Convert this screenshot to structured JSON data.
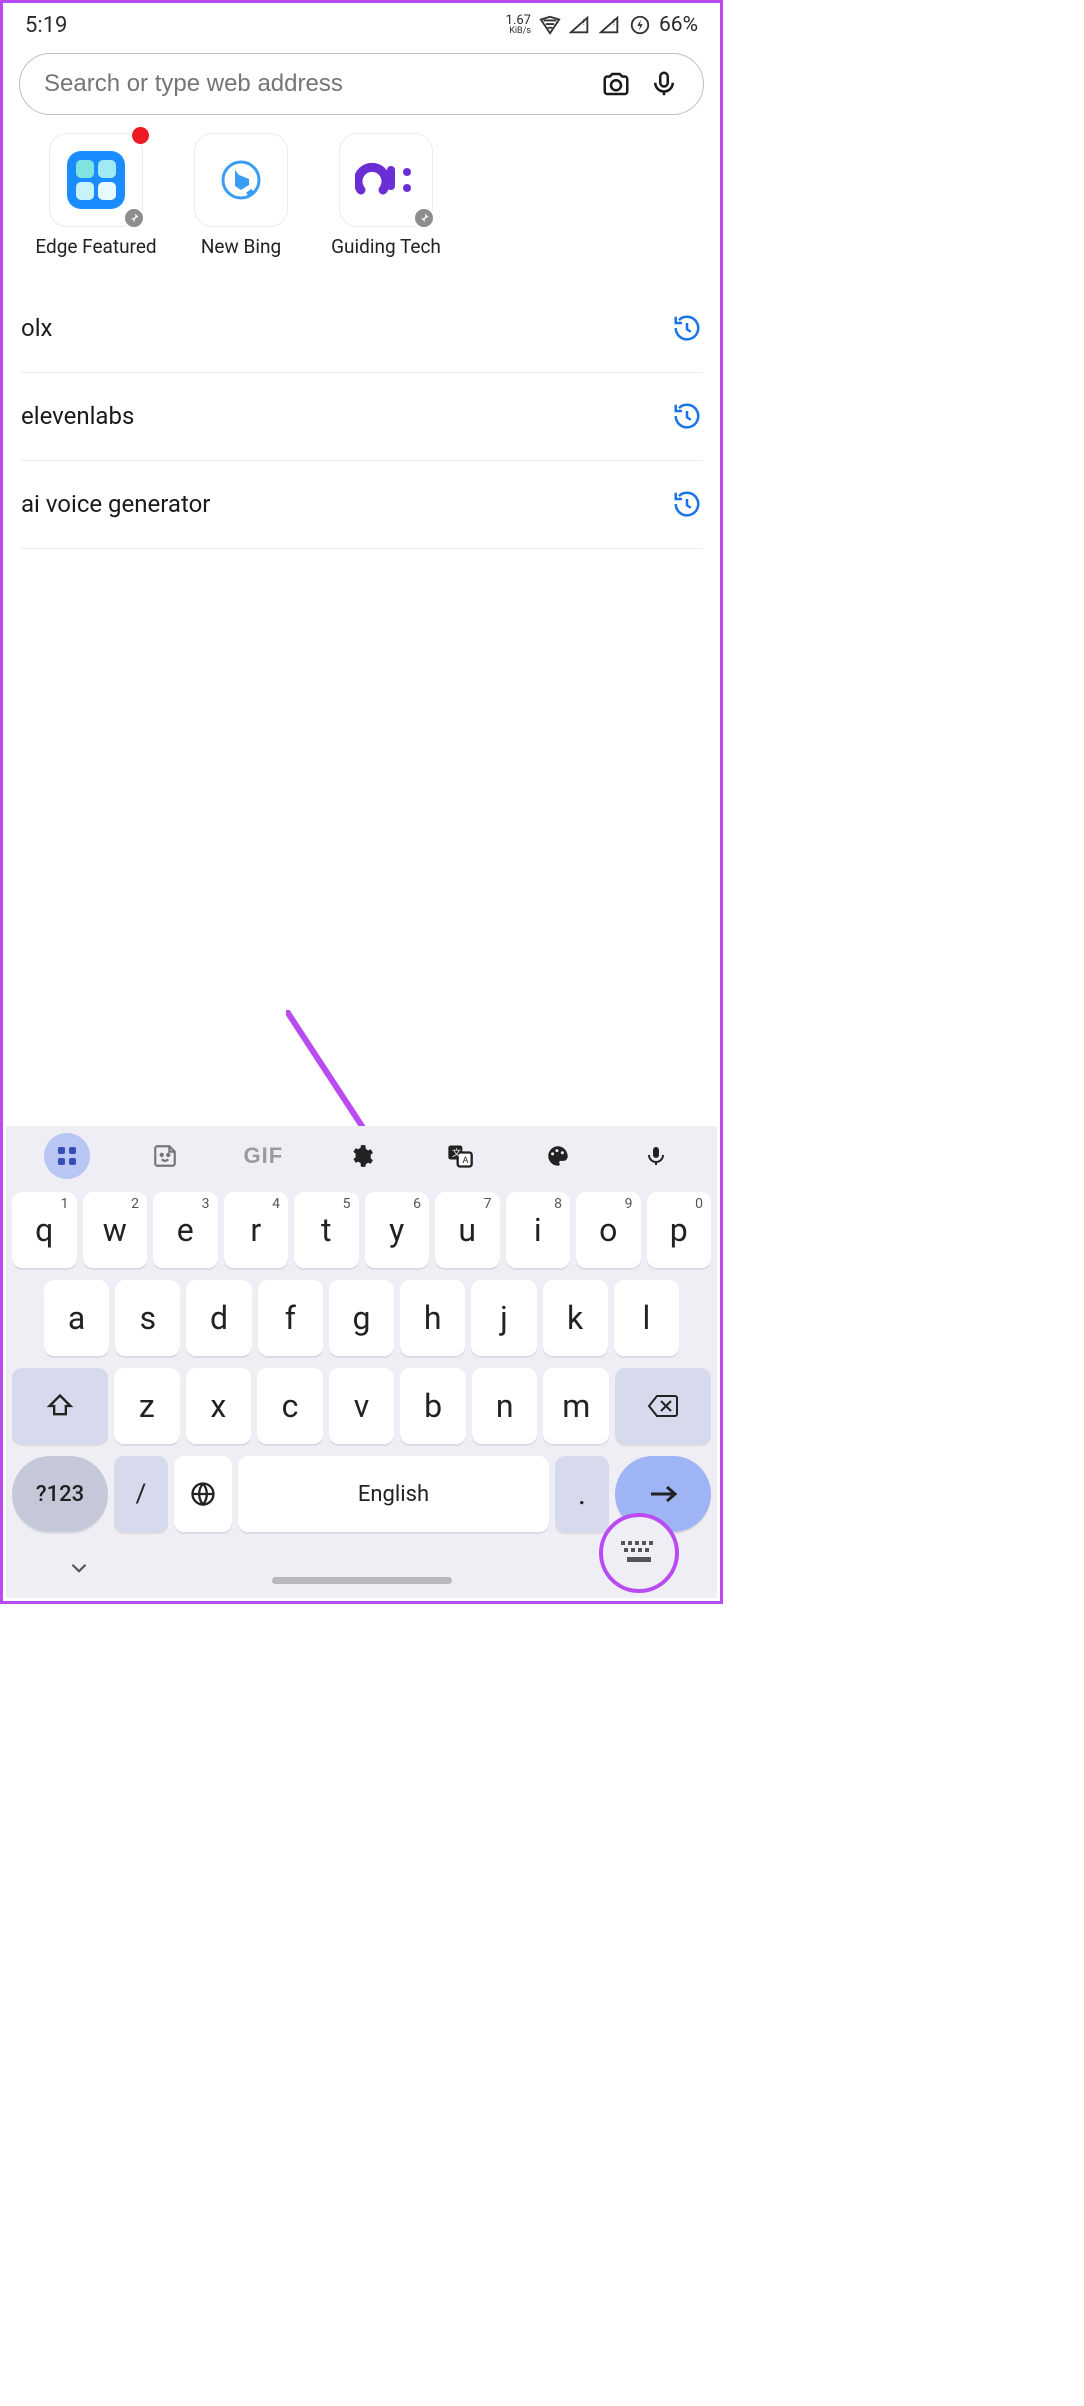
{
  "status": {
    "time": "5:19",
    "kib_top": "1.67",
    "kib_bot": "KiB/s",
    "battery": "66%"
  },
  "address": {
    "placeholder": "Search or type web address"
  },
  "dials": [
    {
      "label": "Edge Featured"
    },
    {
      "label": "New Bing"
    },
    {
      "label": "Guiding Tech"
    }
  ],
  "suggestions": [
    {
      "text": "olx"
    },
    {
      "text": "elevenlabs"
    },
    {
      "text": "ai voice generator"
    }
  ],
  "keyboard": {
    "gif": "GIF",
    "row1": [
      {
        "k": "q",
        "h": "1"
      },
      {
        "k": "w",
        "h": "2"
      },
      {
        "k": "e",
        "h": "3"
      },
      {
        "k": "r",
        "h": "4"
      },
      {
        "k": "t",
        "h": "5"
      },
      {
        "k": "y",
        "h": "6"
      },
      {
        "k": "u",
        "h": "7"
      },
      {
        "k": "i",
        "h": "8"
      },
      {
        "k": "o",
        "h": "9"
      },
      {
        "k": "p",
        "h": "0"
      }
    ],
    "row2": [
      {
        "k": "a"
      },
      {
        "k": "s"
      },
      {
        "k": "d"
      },
      {
        "k": "f"
      },
      {
        "k": "g"
      },
      {
        "k": "h"
      },
      {
        "k": "j"
      },
      {
        "k": "k"
      },
      {
        "k": "l"
      }
    ],
    "row3": [
      {
        "k": "z"
      },
      {
        "k": "x"
      },
      {
        "k": "c"
      },
      {
        "k": "v"
      },
      {
        "k": "b"
      },
      {
        "k": "n"
      },
      {
        "k": "m"
      }
    ],
    "sym": "?123",
    "slash": "/",
    "space": "English",
    "dot": "."
  }
}
